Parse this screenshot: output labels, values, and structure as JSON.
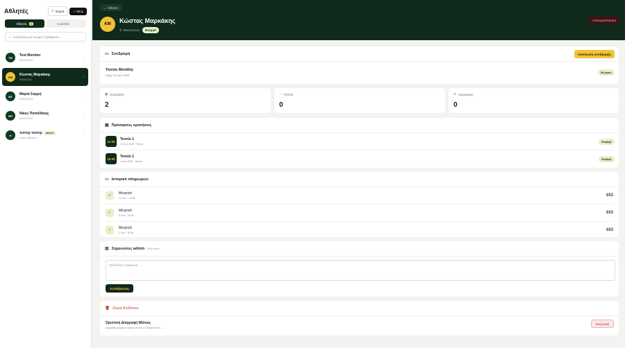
{
  "sidebar": {
    "title": "Αθλητές",
    "import_label": "Import",
    "new_label": "Νέος",
    "tabs": [
      {
        "label": "Αθλητές",
        "count": "5"
      },
      {
        "label": "Coaches",
        "count": "1"
      }
    ],
    "search_placeholder": "Αναζήτηση με όνομα ή τηλέφωνο...",
    "members": [
      {
        "initials": "TM",
        "name": "Test Member",
        "sub": "6944000000",
        "badge": ""
      },
      {
        "initials": "KM",
        "name": "Κώστας Μαρκάκης",
        "sub": "6944111111",
        "badge": ""
      },
      {
        "initials": "ΜΣ",
        "name": "Μαρία Σαρρή",
        "sub": "6944333333",
        "badge": ""
      },
      {
        "initials": "ΝΠ",
        "name": "Νίκος Παπαδάκης",
        "sub": "6944222222",
        "badge": ""
      },
      {
        "initials": "ττ",
        "name": "τεστερ τεστερ",
        "sub": "Χωρίς τηλέφωνο",
        "badge": "IMPORT"
      }
    ]
  },
  "hero": {
    "back_label": "← Αθλητές",
    "initials": "KM",
    "name": "Κώστας Μαρκάκης",
    "phone": "6944111111",
    "status": "Ενεργό",
    "deactivate_label": "Απενεργοποίηση"
  },
  "subscription": {
    "title": "Συνδρομή",
    "renew_label": "Ανανέωση συνδρομής",
    "plan": "Tennis Monthly",
    "expires": "Λήξη: 21 Ιουλ 2026",
    "duration": "30 μέρες"
  },
  "stats": [
    {
      "label": "Κρατήσεις",
      "value": "2"
    },
    {
      "label": "Πόντοι",
      "value": "0"
    },
    {
      "label": "Ακυρώσεις",
      "value": "0"
    }
  ],
  "bookings": {
    "title": "Πρόσφατες κρατήσεις",
    "items": [
      {
        "time": "11:00",
        "name": "Tennis 1",
        "date": "11 Ιουλ 2026 · Tennis",
        "status": "Επιβεβ."
      },
      {
        "time": "19:00",
        "name": "Tennis 1",
        "date": "4 Ιουλ 2026 · Tennis",
        "status": "Επιβεβ."
      }
    ]
  },
  "payments": {
    "title": "Ιστορικό πληρωμών",
    "items": [
      {
        "method": "Μετρητά",
        "date": "21 Ιουν · 15:48",
        "amount": "€63"
      },
      {
        "method": "Μετρητά",
        "date": "6 Ιουν · 18:36",
        "amount": "€63"
      },
      {
        "method": "Μετρητά",
        "date": "2 Ιουν · 20:48",
        "amount": "€63"
      }
    ]
  },
  "notes": {
    "title": "Σημειώσεις admin",
    "subtitle": "(ιδιωτικές)",
    "placeholder": "Πρόσθεσε σημείωση...",
    "save_label": "Αποθήκευση"
  },
  "danger": {
    "title": "Ζώνη Κινδύνου",
    "item_title": "Οριστική Διαγραφή Μέλους",
    "item_desc": "Διαγράφει μόνιμα το μέλος και όλα τα δεδομένα του.",
    "delete_label": "Διαγραφή"
  },
  "colors": {
    "dark": "#0f2a1b",
    "accent": "#f2c335",
    "danger": "#c0392b"
  }
}
